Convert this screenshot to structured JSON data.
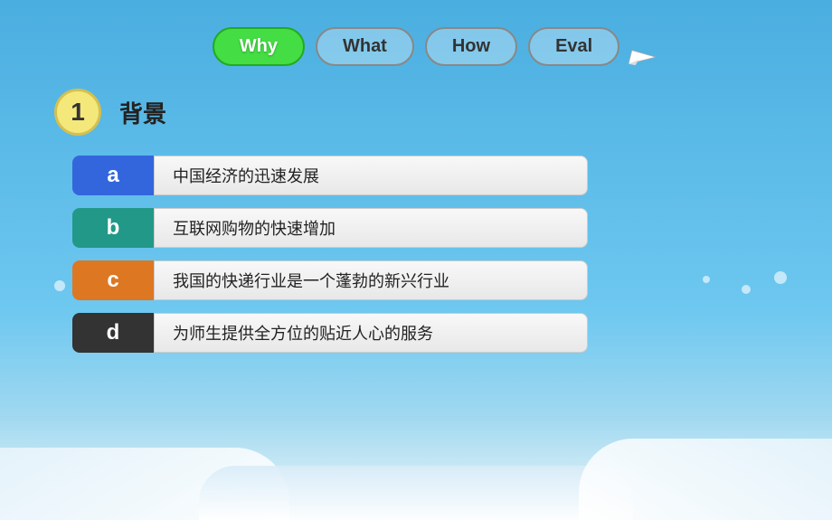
{
  "background": {
    "color": "#5bb8e8"
  },
  "nav": {
    "tabs": [
      {
        "id": "why",
        "label": "Why",
        "active": true
      },
      {
        "id": "what",
        "label": "What",
        "active": false
      },
      {
        "id": "how",
        "label": "How",
        "active": false
      },
      {
        "id": "eval",
        "label": "Eval",
        "active": false
      }
    ]
  },
  "section": {
    "number": "1",
    "title": "背景"
  },
  "items": [
    {
      "id": "a",
      "label": "a",
      "colorClass": "blue",
      "text": "中国经济的迅速发展"
    },
    {
      "id": "b",
      "label": "b",
      "colorClass": "teal",
      "text": "互联网购物的快速增加"
    },
    {
      "id": "c",
      "label": "c",
      "colorClass": "orange",
      "text": "我国的快递行业是一个蓬勃的新兴行业"
    },
    {
      "id": "d",
      "label": "d",
      "colorClass": "dark",
      "text": "为师生提供全方位的贴近人心的服务"
    }
  ]
}
